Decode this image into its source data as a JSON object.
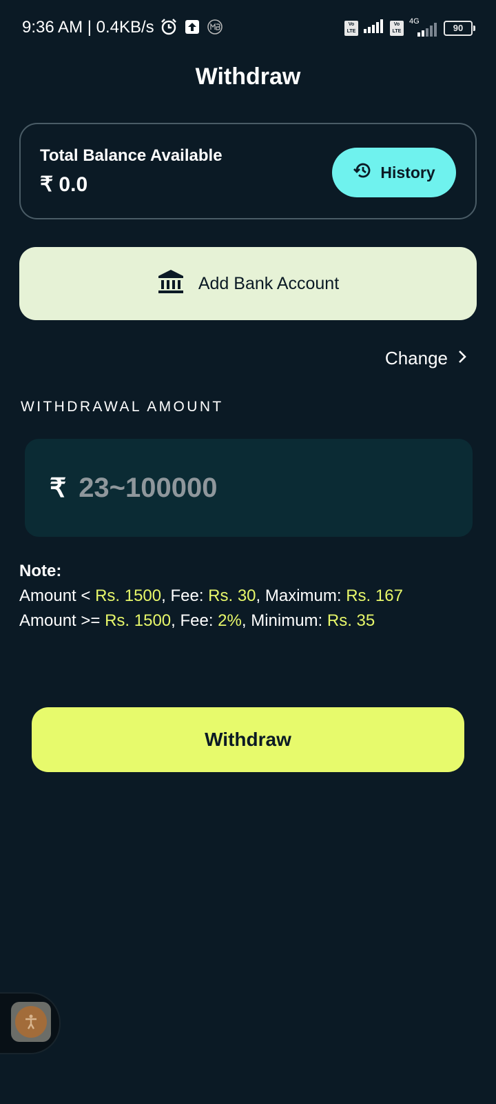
{
  "status_bar": {
    "time": "9:36 AM | 0.4KB/s",
    "sim1_badge_top": "Vo",
    "sim1_badge_bottom": "LTE",
    "sim2_badge_top": "Vo",
    "sim2_badge_bottom": "LTE",
    "network_type": "4G",
    "battery": "90"
  },
  "header": {
    "title": "Withdraw"
  },
  "balance_card": {
    "label": "Total Balance Available",
    "value": "₹ 0.0",
    "history_label": "History"
  },
  "bank": {
    "add_label": "Add Bank Account",
    "change_label": "Change"
  },
  "amount": {
    "section_label": "WITHDRAWAL AMOUNT",
    "currency_symbol": "₹",
    "value": "",
    "placeholder": "23~100000"
  },
  "note": {
    "title": "Note:",
    "line1": {
      "p1": "Amount < ",
      "v1": "Rs. 1500",
      "p2": ", Fee: ",
      "v2": "Rs. 30",
      "p3": ", Maximum: ",
      "v3": "Rs. 167"
    },
    "line2": {
      "p1": "Amount >= ",
      "v1": "Rs. 1500",
      "p2": ", Fee: ",
      "v2": "2%",
      "p3": ", Minimum: ",
      "v3": "Rs. 35"
    }
  },
  "actions": {
    "withdraw_label": "Withdraw"
  },
  "colors": {
    "background": "#0b1a25",
    "history_button": "#6ff2ee",
    "add_bank_button": "#e6f2d6",
    "withdraw_button": "#e7fa6c",
    "highlight_text": "#e7f76a",
    "amount_box": "#0b2b34"
  },
  "icons": {
    "alarm": "alarm-icon",
    "upload": "upload-icon",
    "app_badge": "mb-app-icon",
    "signal": "signal-icon",
    "history": "history-icon",
    "bank": "bank-icon",
    "chevron": "chevron-right-icon",
    "accessibility": "accessibility-icon"
  }
}
